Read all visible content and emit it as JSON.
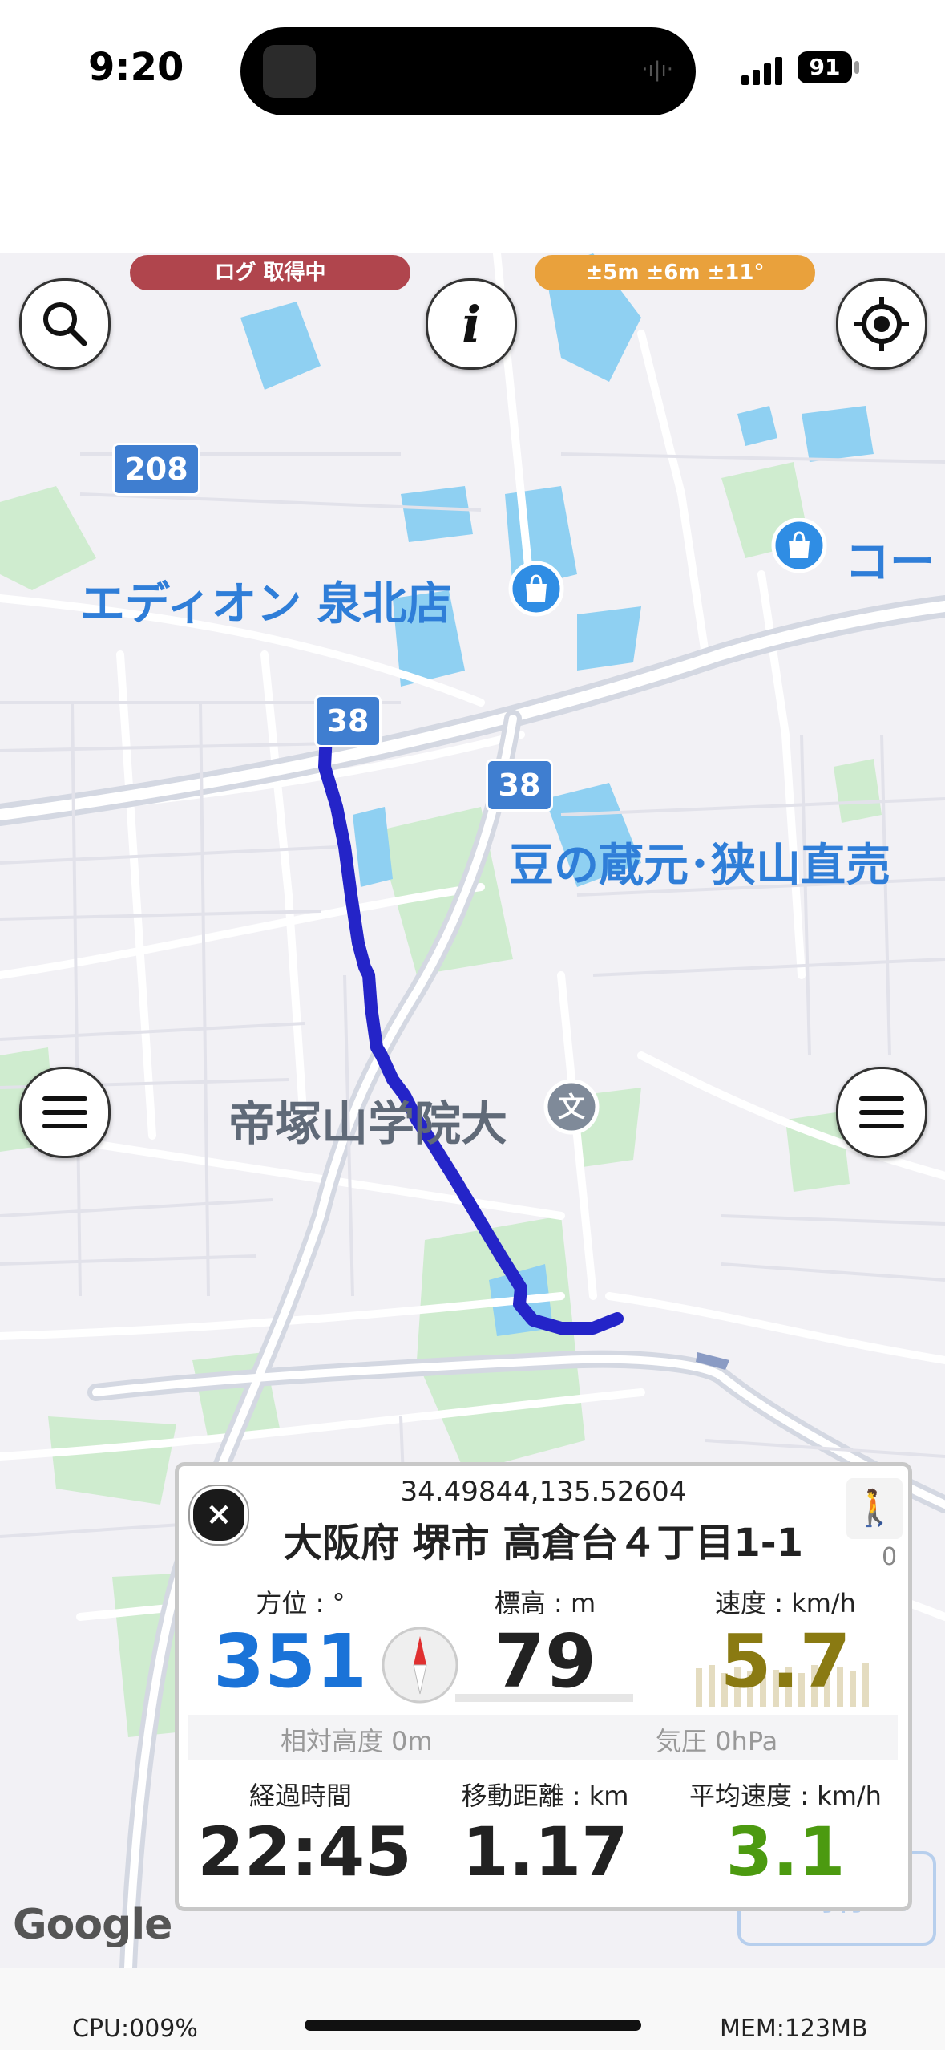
{
  "status": {
    "time": "9:20",
    "battery": "91"
  },
  "map": {
    "pill_logging": "ログ 取得中",
    "pill_accuracy": "±5m ±6m ±11°",
    "place_edion": "エディオン 泉北店",
    "place_mame": "豆の蔵元･狭山直売",
    "place_ko": "コー",
    "place_tezukayama": "帝塚山学院大",
    "route_208": "208",
    "route_38a": "38",
    "route_38b": "38",
    "route_38c": "38",
    "google": "Google",
    "route_color": "#2424c8"
  },
  "panel": {
    "coords": "34.49844,135.52604",
    "address": "大阪府 堺市 高倉台４丁目1-1",
    "steps": "0",
    "heading_label": "方位 : °",
    "heading_value": "351",
    "altitude_label": "標高 : m",
    "altitude_value": "79",
    "speed_label": "速度 : km/h",
    "speed_value": "5.7",
    "relative_alt": "相対高度 0m",
    "pressure": "気圧 0hPa",
    "elapsed_label": "経過時間",
    "elapsed_value": "22:45",
    "distance_label": "移動距離 : km",
    "distance_value": "1.17",
    "avg_speed_label": "平均速度 : km/h",
    "avg_speed_value": "3.1",
    "pause_label": "一時停止",
    "colors": {
      "heading": "#1a73d8",
      "speed": "#8a7a12",
      "avg_speed": "#4c9a10"
    }
  },
  "footer": {
    "cpu": "CPU:009%",
    "mem": "MEM:123MB"
  }
}
